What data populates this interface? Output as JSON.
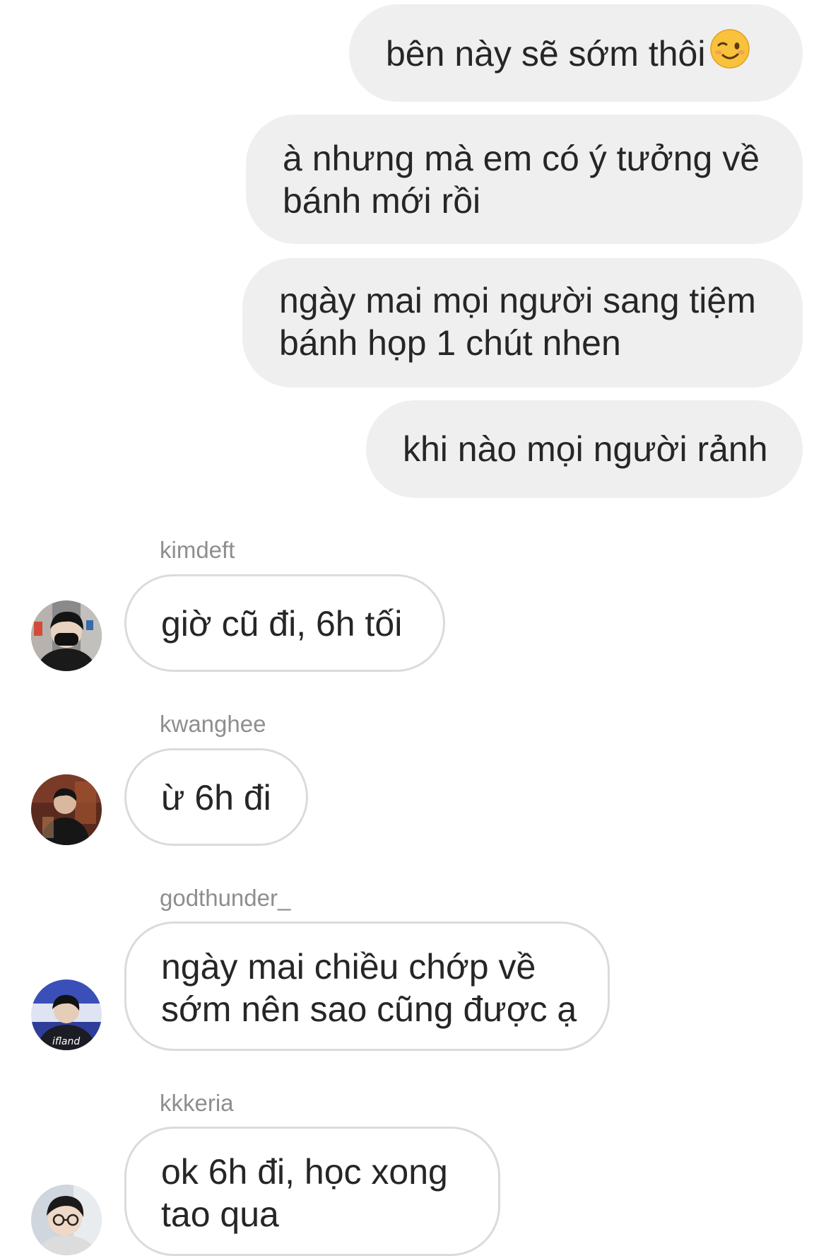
{
  "outgoing": [
    {
      "text": "bên này sẽ sớm thôi",
      "emoji": "winking-face-emoji"
    },
    {
      "line1": "à nhưng mà em có ý tưởng về",
      "line2": "bánh mới rồi"
    },
    {
      "line1": "ngày mai mọi người sang tiệm",
      "line2": "bánh họp 1 chút nhen"
    },
    {
      "text": "khi nào mọi người rảnh"
    }
  ],
  "incoming": [
    {
      "sender": "kimdeft",
      "line1": "giờ cũ đi, 6h tối"
    },
    {
      "sender": "kwanghee",
      "line1": "ừ 6h đi"
    },
    {
      "sender": "godthunder_",
      "line1": "ngày mai chiều chớp về",
      "line2": "sớm nên sao cũng được ạ"
    },
    {
      "sender": "kkkeria",
      "line1": "ok 6h đi, học xong",
      "line2": "tao qua"
    }
  ],
  "colors": {
    "outgoing_bubble": "#efefef",
    "incoming_border": "#dbdbdb",
    "sender_text": "#8e8e8e",
    "message_text": "#262626"
  }
}
